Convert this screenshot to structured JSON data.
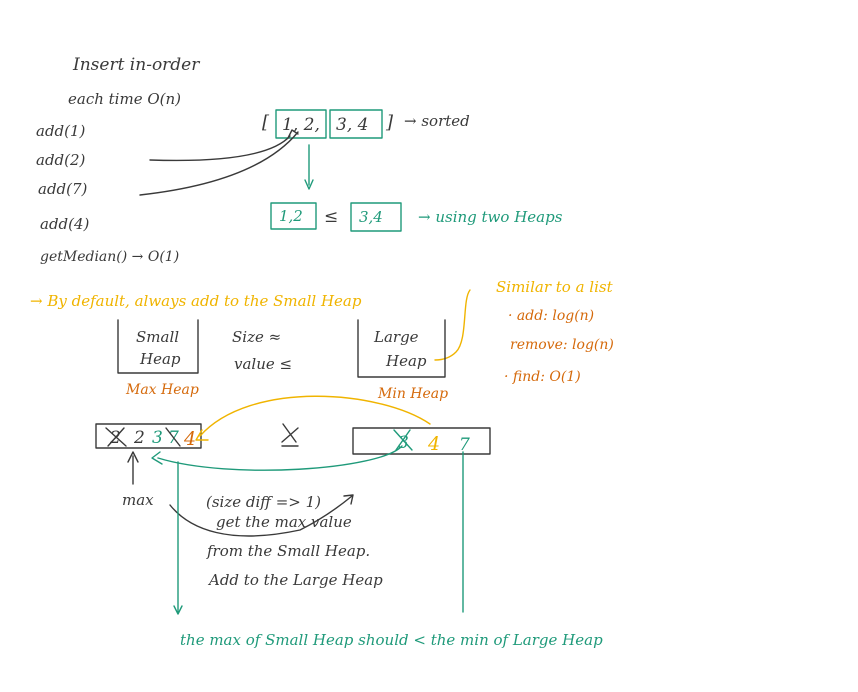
{
  "colors": {
    "ink": "#3a3a3a",
    "teal": "#1f9a7a",
    "yellow": "#f0b400",
    "orange": "#d56a0c"
  },
  "top": {
    "title": "Insert in-order",
    "each_time": "each time O(n)",
    "ops": [
      "add(1)",
      "add(2)",
      "add(7)",
      "add(4)"
    ],
    "get_median": "getMedian() → O(1)",
    "array_open": "[",
    "array_left": "1, 2,",
    "array_right": "3, 4",
    "array_close": "]",
    "sorted_label": "→ sorted",
    "heap_left": "1,2",
    "leq": "≤",
    "heap_right": "3,4",
    "two_heaps_label": "→ using two Heaps"
  },
  "middle": {
    "default_note": "→ By default, always add to the Small Heap",
    "similar_note": [
      "Similar to a list",
      "· add: log(n)",
      "remove: log(n)",
      "· find: O(1)"
    ],
    "small_heap": [
      "Small",
      "Heap"
    ],
    "max_heap": "Max Heap",
    "size": "Size ≈",
    "value": "value ≤",
    "large_heap": [
      "Large",
      "Heap"
    ],
    "min_heap": "Min Heap"
  },
  "bottom": {
    "small_contents": [
      "2",
      "2",
      "3",
      "7",
      "4"
    ],
    "large_contents": [
      "3",
      "4",
      "7"
    ],
    "max_label": "max",
    "steps": [
      "(size diff => 1)",
      "get the max value",
      "from the Small Heap.",
      "Add to the Large Heap"
    ],
    "footer": "the max of Small Heap should < the min of Large Heap"
  }
}
